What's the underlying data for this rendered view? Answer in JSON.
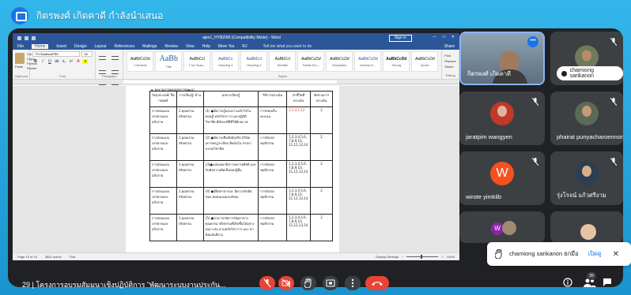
{
  "presenter": {
    "label": "กิตรพงศ์ เกิดคาดี กำลังนำเสนอ"
  },
  "word": {
    "doc_title": "ajeo1_HYBZ0M (Compatibility Mode) - Word",
    "sign_in": "Sign in",
    "tabs": [
      "File",
      "Home",
      "Insert",
      "Design",
      "Layout",
      "References",
      "Mailings",
      "Review",
      "View",
      "Help",
      "More Tes",
      "RJ"
    ],
    "active_tab": "Home",
    "tell_me": "Tell me what you want to do",
    "share": "Share",
    "paste_label": "Paste",
    "cut_label": "Cut",
    "copy_label": "Copy",
    "format_painter": "Format Painter",
    "clipboard_group": "Clipboard",
    "font_name": "TH SarabunPSK",
    "font_size": "16",
    "font_group": "Font",
    "paragraph_group": "Paragraph",
    "styles_group": "Styles",
    "editing_group": "Editing",
    "styles": [
      {
        "sample": "AaBbCcDd",
        "name": "1 Normal"
      },
      {
        "sample": "AaBb",
        "name": "Title"
      },
      {
        "sample": "AaBbCcl",
        "name": "1 No Spac..."
      },
      {
        "sample": "AaBbCc",
        "name": "Heading 1"
      },
      {
        "sample": "AaBbCcl",
        "name": "Heading 2"
      },
      {
        "sample": "AaBbCcl",
        "name": "Subtitle"
      },
      {
        "sample": "AaBbCcDd",
        "name": "Subtle Em..."
      },
      {
        "sample": "AaBbCcDd",
        "name": "Emphasis"
      },
      {
        "sample": "AaBbCcDd",
        "name": "Intense E..."
      },
      {
        "sample": "AaBbCcDd",
        "name": "Strong"
      },
      {
        "sample": "AaBbCcDd",
        "name": "Quote"
      }
    ],
    "find": "Find",
    "replace": "Replace",
    "select": "Select",
    "status_page": "Page 10 of 15",
    "status_words": "3801 words",
    "status_lang": "Thai",
    "display_settings": "Display Settings",
    "zoom": "100%",
    "doc_heading": "๑. ผลงานการคดเลอกการพฒนา",
    "table_headers": [
      "วัตถุประสงค์/ ชื่อกลยุทธ์",
      "การเรียนรู้/ ด้าน",
      "ผลการเรียนรู้",
      "วิธีการประเมิน",
      "ตัวชี้วัดที่ ประเมิน",
      "สัดส่วนการ ประเมิน"
    ],
    "table_rows": [
      [
        "การสอนแบบ บรรยายและ อภิปราย",
        "1.คุณธรรม จริยธรรม",
        "(1) ●มีความรู้และความเข้าใจใน ทฤษฎี หลักวิชาการ และปฏิบัติ วิชาชีพ มีทักษะที่ดีที่ใช้ศักยภาพ",
        "การสอบเก็บคะแนน",
        "1.2,4,5,12",
        "2"
      ],
      [
        "การสอนแบบ บรรยายและ อภิปราย",
        "1.คุณธรรม จริยธรรม",
        "(2) ●มีความซื่อสัตย์สุจริต มีวินัย เคารพกฎระเบียบ ยึดมั่นใน จรรยาบรรณวิชาชีพ",
        "การสังเกต พฤติกรรม",
        "1,2,3,4,5,6, 7,8,9,10, 11,12,13,14",
        "2"
      ],
      [
        "การสอนแบบ บรรยายและ อภิปราย",
        "1.คุณธรรม จริยธรรม",
        "(3)●แสดงออกถึงการเคารพสิทธิ และรับฟังความคิดเห็นของผู้อื่น",
        "การสังเกต พฤติกรรม",
        "1,2,3,4,5,6, 7,8,9,10, 11,12,13,14",
        "2"
      ],
      [
        "การสอนแบบ บรรยายและ อภิปราย",
        "1.คุณธรรม จริยธรรม",
        "(4) ●มีจิตสาธารณะ มีความรับผิดชอบ ต่อตนเองและสังคม",
        "การสังเกต พฤติกรรม",
        "1,2,3,4,5,6, 7,8,9,10, 11,12,13,14",
        "2"
      ],
      [
        "การสอนแบบ บรรยายและ อภิปราย",
        "1.คุณธรรม จริยธรรม",
        "(5) ●สามารถจัดการปัญหาทาง คุณธรรม จริยธรรมที่เกิดขึ้นได้อย่าง เหมาะสม ตามหลักวิชาการ และ ค่านิยมอันดีงาม",
        "การสังเกต พฤติกรรม",
        "1,2,3,4,5,6, 7,8,9,10, 11,12,13,14",
        "2"
      ]
    ]
  },
  "participants": [
    {
      "name": "กิตรพงศ์ เกิดคาดี",
      "color": "#6b7d8f"
    },
    {
      "name": "chamiong sarikanon",
      "color": "#4e5a4a"
    },
    {
      "name": "jaratpim wangyen",
      "color": "#5a4a4e"
    },
    {
      "name": "phairat punyacharoennon",
      "color": "#3f4a52"
    },
    {
      "name": "wirote yimklib",
      "initial": "W",
      "color": "#f4511e"
    },
    {
      "name": "รุ่งโรจน์ แก้วศรีงาม",
      "color": "#4a5a6a"
    },
    {
      "name": "",
      "initial": "W",
      "color": "#8e24aa"
    },
    {
      "name": "",
      "color": "#5a5045"
    }
  ],
  "notification": {
    "text": "chamiong sarikanon ยกมือ",
    "action": "เปิดดู"
  },
  "bottom": {
    "meeting_title": "29  |  โครงการอบรมสัมมนาเชิงปฏิบัติการ \"พัฒนาระบบงานประกัน...",
    "people_count": "39"
  },
  "colors": {
    "accent": "#1a73e8",
    "danger": "#ea4335",
    "meet_bg": "#202124",
    "word_blue": "#2b579a"
  }
}
